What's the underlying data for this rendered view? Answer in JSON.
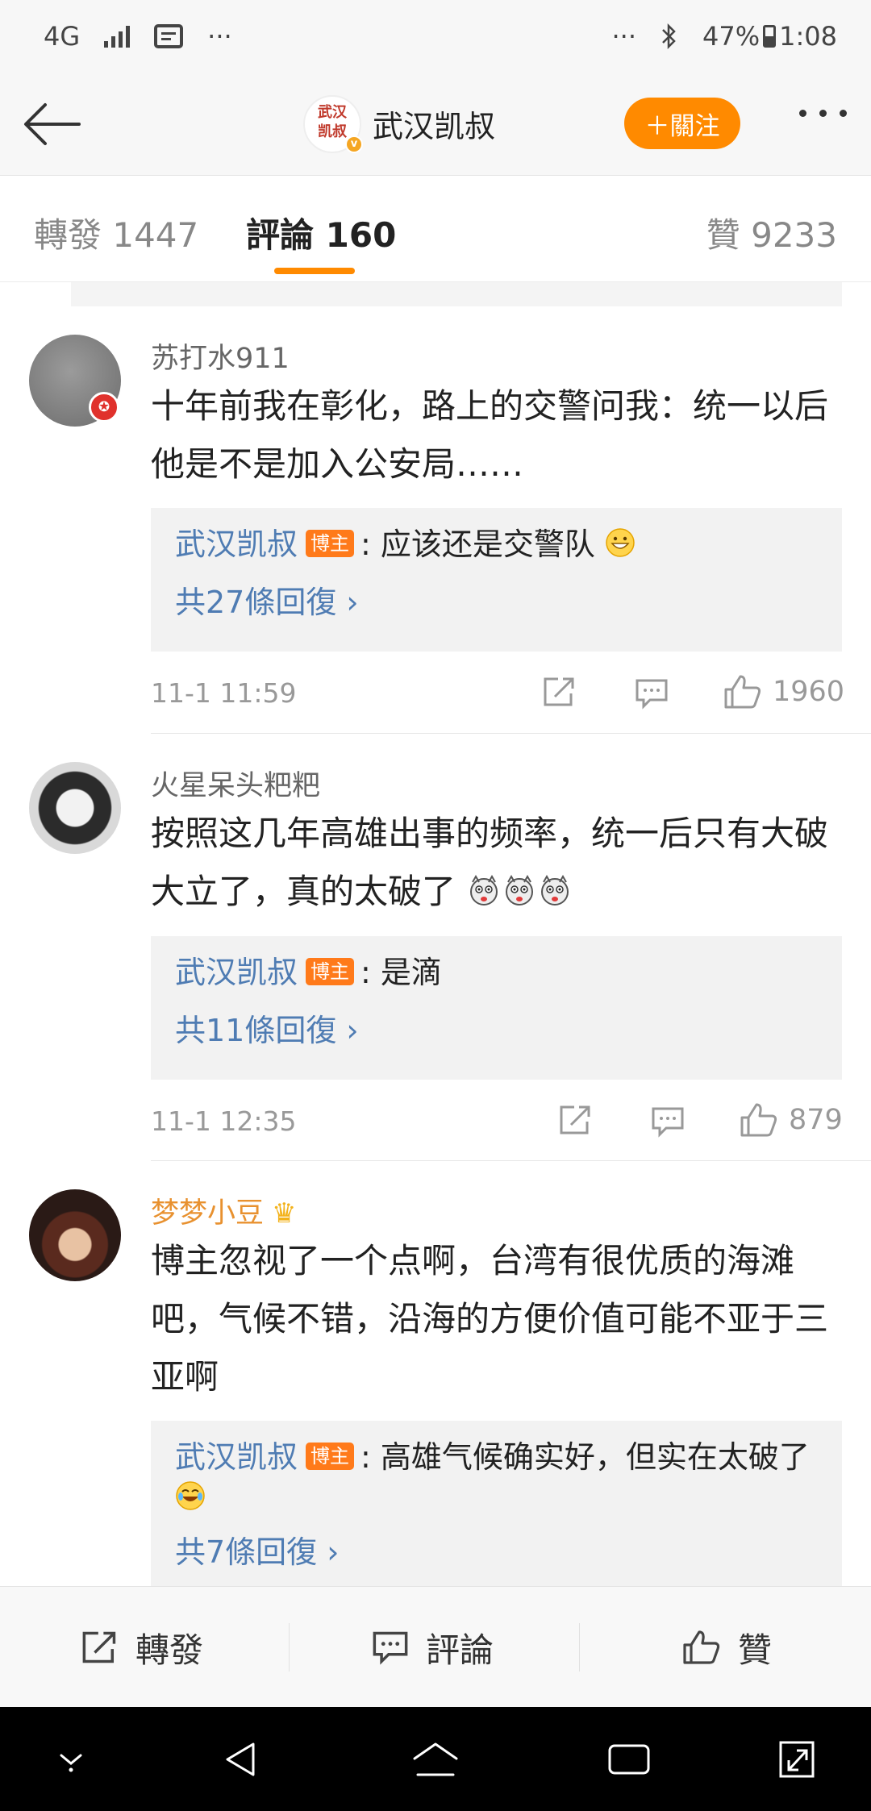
{
  "status_bar": {
    "network": "4G",
    "more_left": "···",
    "more_right": "···",
    "battery": "47%",
    "time": "1:08"
  },
  "nav": {
    "title": "武汉凯叔",
    "avatar_text": "武汉凯叔",
    "follow_label": "＋關注"
  },
  "tabs": {
    "repost": "轉發 1447",
    "comments": "評論 160",
    "likes": "贊 9233"
  },
  "comments": [
    {
      "user": "苏打水911",
      "text": "十年前我在彰化，路上的交警问我：统一以后他是不是加入公安局……",
      "reply_author": "武汉凯叔",
      "owner_tag": "博主",
      "reply_text": ": 应该还是交警队",
      "reply_count": "共27條回復 ›",
      "time": "11-1 11:59",
      "likes": "1960"
    },
    {
      "user": "火星呆头粑粑",
      "text": "按照这几年高雄出事的频率，统一后只有大破大立了，真的太破了",
      "reply_author": "武汉凯叔",
      "owner_tag": "博主",
      "reply_text": ": 是滴",
      "reply_count": "共11條回復 ›",
      "time": "11-1 12:35",
      "likes": "879"
    },
    {
      "user": "梦梦小豆",
      "text": "博主忽视了一个点啊，台湾有很优质的海滩吧，气候不错，沿海的方便价值可能不亚于三亚啊",
      "reply_author": "武汉凯叔",
      "owner_tag": "博主",
      "reply_text": ": 高雄气候确实好，但实在太破了",
      "reply_count": "共7條回復 ›"
    }
  ],
  "bottom_bar": {
    "repost": "轉發",
    "comment": "評論",
    "like": "贊"
  },
  "icons": {
    "back": "arrow-left-icon",
    "more": "more-dots-icon",
    "share": "share-icon",
    "comment": "comment-icon",
    "like": "thumbs-up-icon"
  },
  "colors": {
    "accent": "#ff8a00",
    "link": "#4f7cb3",
    "owner_tag": "#ff7a1a",
    "vip_name": "#e8912f"
  }
}
